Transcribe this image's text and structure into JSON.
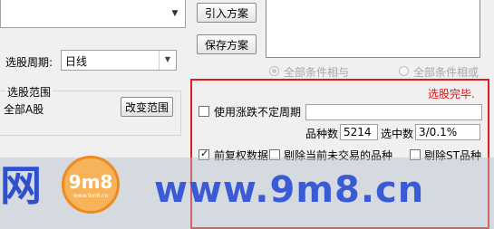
{
  "left_panel": {
    "period_label": "选股周期:",
    "period_value": "日线",
    "range_group_title": "选股范围",
    "range_value": "全部A股",
    "change_range_label": "改变范围"
  },
  "right_panel": {
    "import_label": "引入方案",
    "save_label": "保存方案",
    "radio_and_label": "全部条件相与",
    "radio_or_label": "全部条件相或",
    "status_text": "选股完毕.",
    "use_period_label": "使用涨跌不定周期",
    "count_label": "品种数",
    "count_value": "5214",
    "selected_label": "选中数",
    "selected_value": "3/0.1%",
    "opt1_label": "前复权数据",
    "opt2_label": "剔除当前未交易的品种",
    "opt3_label": "剔除ST品种"
  },
  "watermark": {
    "left_char": "网",
    "logo_text": "9m8",
    "url_text": "www.9m8.cn",
    "logo_small": "www.9m8.cn"
  },
  "colors": {
    "accent_red": "#e21c1c",
    "watermark_blue": "#3b5bd6",
    "logo_orange": "#f08a1c"
  }
}
